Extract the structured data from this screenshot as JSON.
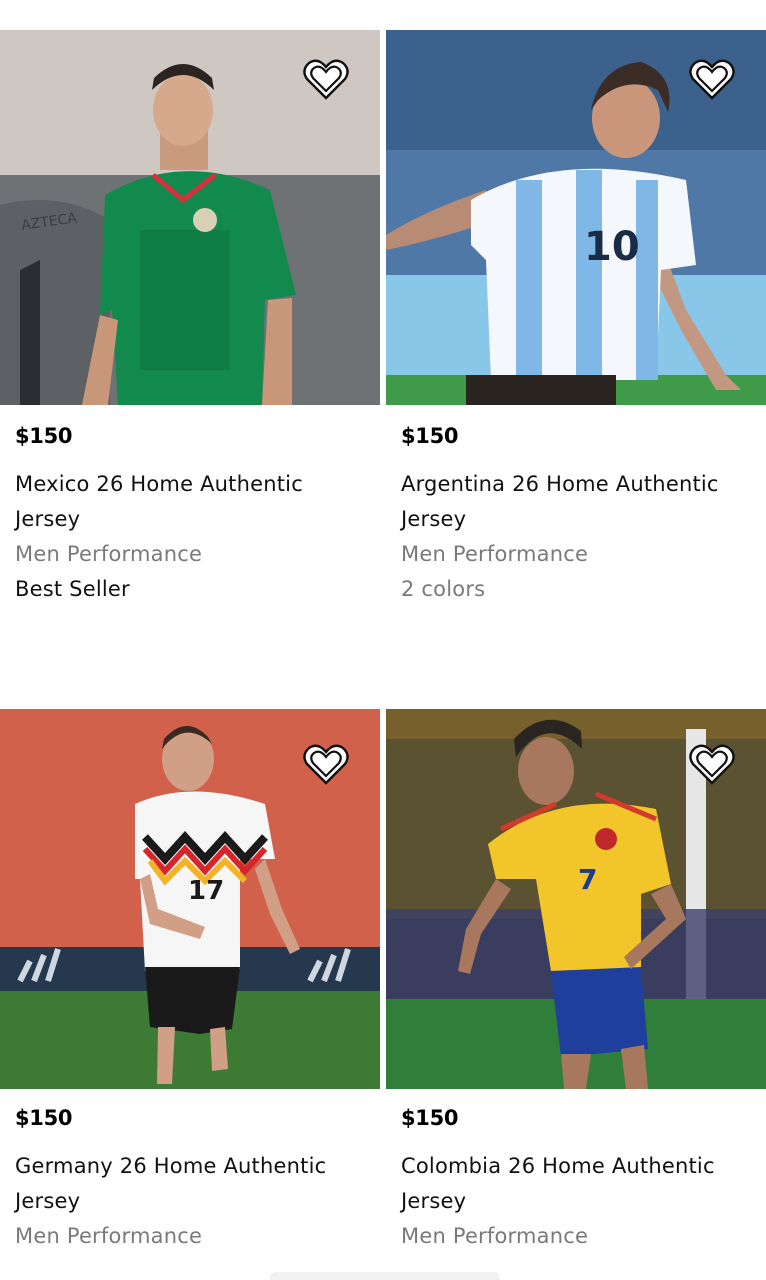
{
  "products": [
    {
      "price": "$150",
      "name": "Mexico 26 Home Authentic Jersey",
      "category": "Men Performance",
      "badge": "Best Seller",
      "jersey_color": "#128a4e",
      "jersey_number": ""
    },
    {
      "price": "$150",
      "name": "Argentina 26 Home Authentic Jersey",
      "category": "Men Performance",
      "badge": "2 colors",
      "jersey_color": "#7fb8e6",
      "jersey_number": "10"
    },
    {
      "price": "$150",
      "name": "Germany 26 Home Authentic Jersey",
      "category": "Men Performance",
      "badge": "",
      "jersey_color": "#ffffff",
      "jersey_number": "17"
    },
    {
      "price": "$150",
      "name": "Colombia 26 Home Authentic Jersey",
      "category": "Men Performance",
      "badge": "",
      "jersey_color": "#f2c52a",
      "jersey_number": "7"
    }
  ],
  "icons": {
    "favorite": "heart-outline-icon"
  }
}
